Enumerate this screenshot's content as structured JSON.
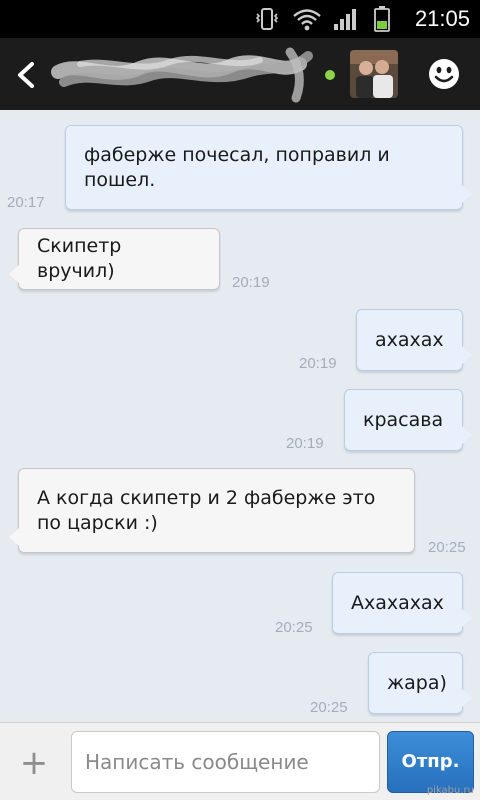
{
  "status_bar": {
    "time": "21:05"
  },
  "header": {
    "contact_name": "",
    "online": true
  },
  "messages": [
    {
      "direction": "out",
      "lines": [
        "фаберже почесал, поправил и",
        "пошел."
      ],
      "time": "20:17"
    },
    {
      "direction": "in",
      "lines": [
        "Скипетр вручил)"
      ],
      "time": "20:19"
    },
    {
      "direction": "out",
      "lines": [
        "ахахах"
      ],
      "time": "20:19"
    },
    {
      "direction": "out",
      "lines": [
        "красава"
      ],
      "time": "20:19"
    },
    {
      "direction": "in",
      "lines": [
        "А когда скипетр и 2 фаберже это",
        "по царски :)"
      ],
      "time": "20:25"
    },
    {
      "direction": "out",
      "lines": [
        "Ахахахах"
      ],
      "time": "20:25"
    },
    {
      "direction": "out",
      "lines": [
        "жара)"
      ],
      "time": "20:25"
    }
  ],
  "input_bar": {
    "placeholder": "Написать сообщение",
    "send_label": "Отпр.",
    "attach_icon": "plus-icon"
  },
  "watermark": "pikabu.ru",
  "colors": {
    "send_button": "#2f7fcf",
    "online_dot": "#8cd34a",
    "outgoing_bubble": "#e8f1fb",
    "incoming_bubble": "#f6f6f6"
  }
}
